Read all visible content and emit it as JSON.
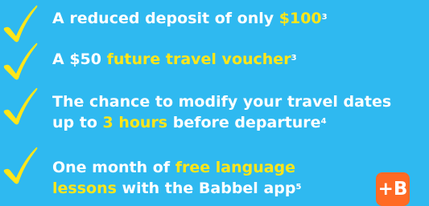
{
  "benefits": [
    {
      "parts": [
        "A reduced deposit of only ",
        "$100",
        ""
      ],
      "sup": "3"
    },
    {
      "parts": [
        "A $50 ",
        "future travel voucher",
        ""
      ],
      "sup": "3"
    },
    {
      "line1": "The chance to modify your travel dates",
      "parts": [
        "up to ",
        "3 hours",
        " before departure"
      ],
      "sup": "4"
    },
    {
      "line1_parts": [
        "One month of ",
        "free language"
      ],
      "parts": [
        "lessons",
        " with the Babbel app"
      ],
      "sup": "5"
    }
  ],
  "babbel_logo_text": "+B",
  "colors": {
    "background": "#2fb9f0",
    "checkmark": "#ffe619",
    "highlight": "#ffe619",
    "text": "#ffffff",
    "babbel": "#ff6a24"
  },
  "icons": {
    "check": "checkmark-icon",
    "babbel": "babbel-app-icon"
  }
}
